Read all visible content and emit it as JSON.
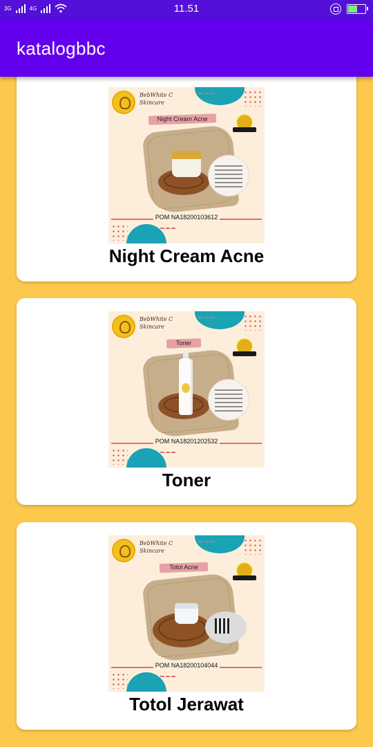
{
  "status_bar": {
    "network_left": "3G",
    "network_right": "4G",
    "time": "11.51"
  },
  "app_bar": {
    "title": "katalogbbc"
  },
  "products": [
    {
      "name": "Night Cream Acne",
      "brand": "BebWhite C",
      "brand_sub": "Skincare",
      "ribbon": "Night Cream Acne",
      "pom": "POM NA18200103612"
    },
    {
      "name": "Toner",
      "brand": "BebWhite C",
      "brand_sub": "Skincare",
      "ribbon": "Toner",
      "pom": "POM NA18201202532"
    },
    {
      "name": "Totol Jerawat",
      "brand": "BebWhite C",
      "brand_sub": "Skincare",
      "ribbon": "Totol Acne",
      "pom": "POM NA18200104044"
    }
  ]
}
